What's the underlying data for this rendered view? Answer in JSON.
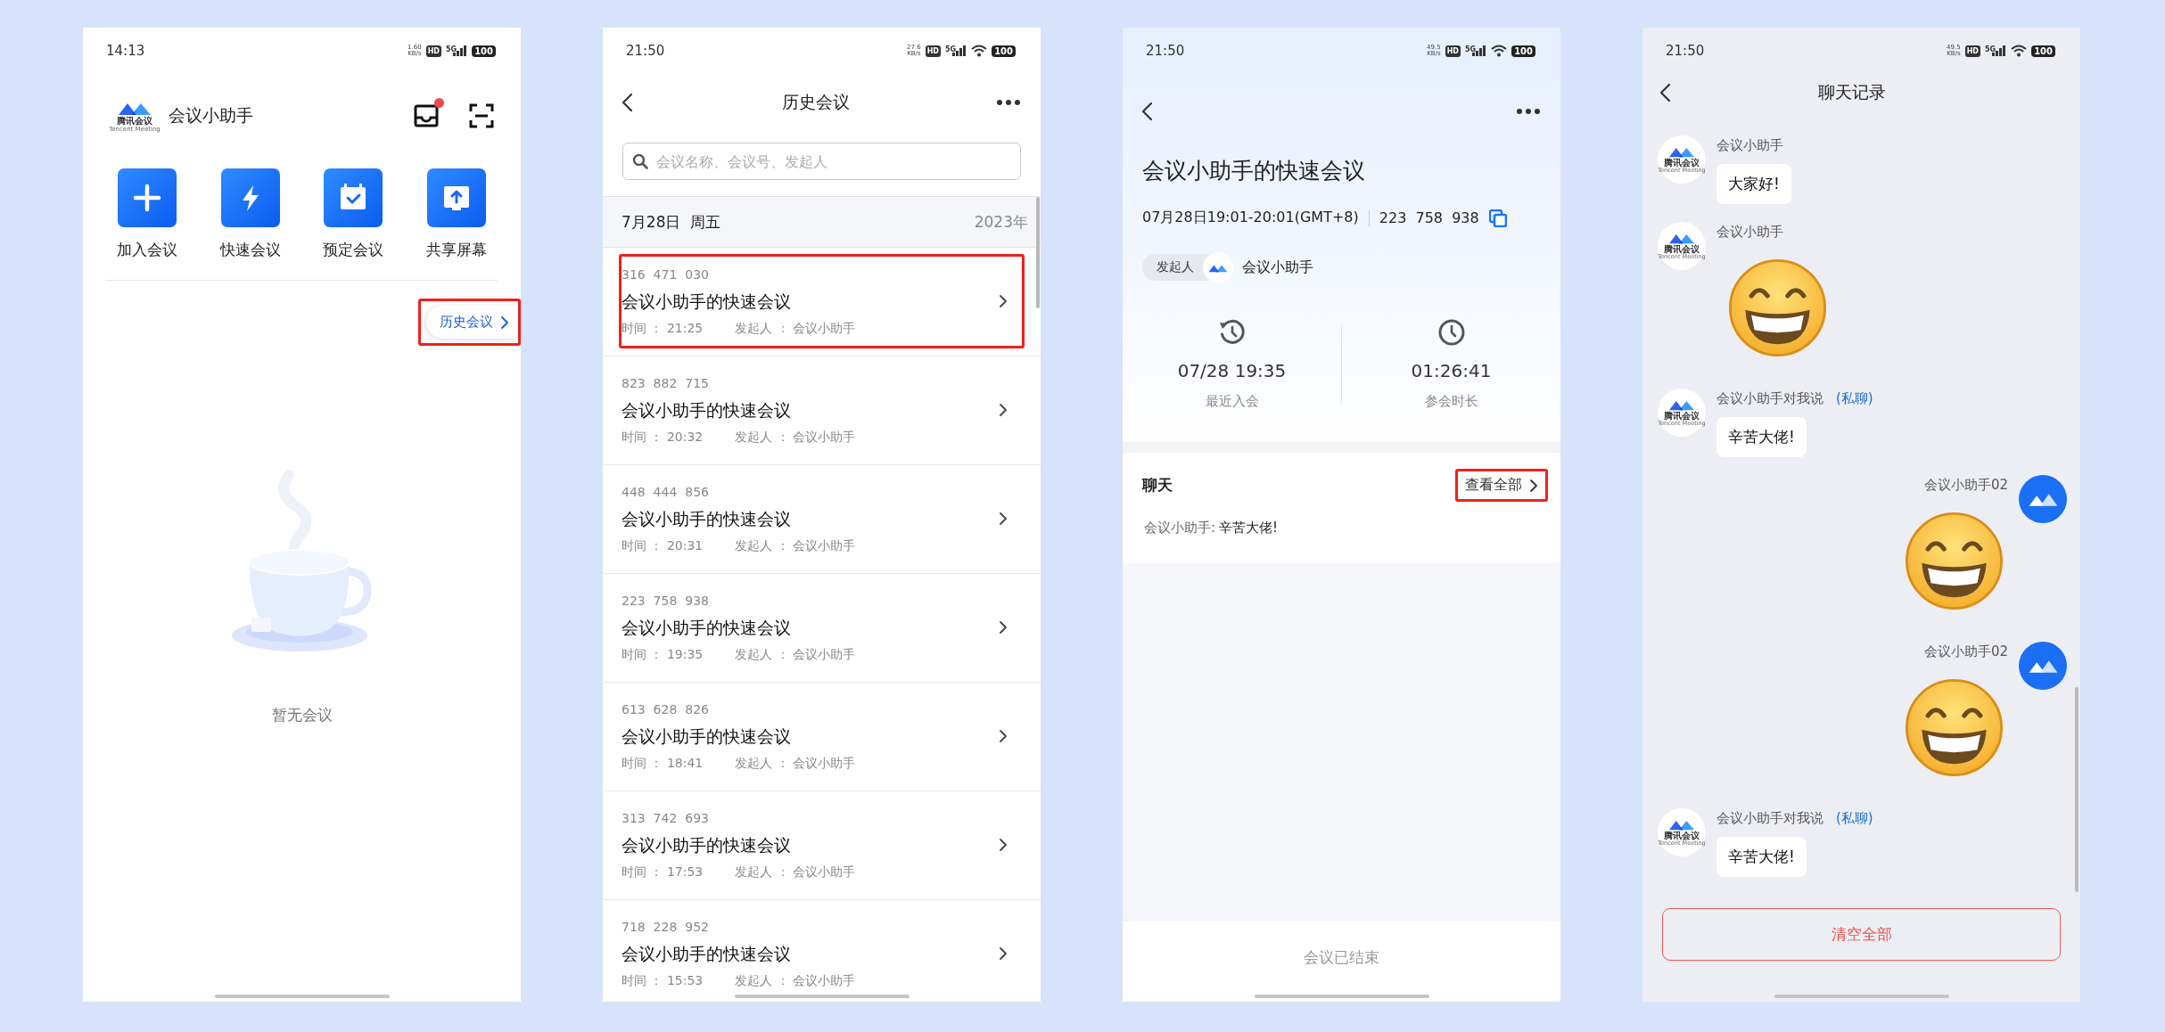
{
  "screens": [
    {
      "kind": "home",
      "status": {
        "time": "14:13",
        "speed": "1.60",
        "speed_unit": "KB/s",
        "hd": "HD",
        "network": "5G",
        "wifi": false,
        "battery": "100"
      },
      "logo": {
        "name": "腾讯会议",
        "sub": "Tencent Meeting"
      },
      "app_title": "会议小助手",
      "inbox_unread": true,
      "actions": [
        {
          "label": "加入会议",
          "kind": "plus"
        },
        {
          "label": "快速会议",
          "kind": "bolt"
        },
        {
          "label": "预定会议",
          "kind": "calendar"
        },
        {
          "label": "共享屏幕",
          "kind": "share"
        }
      ],
      "history_button": {
        "label": "历史会议",
        "highlighted": true
      },
      "empty_text": "暂无会议"
    },
    {
      "kind": "history",
      "status": {
        "time": "21:50",
        "speed": "27.6",
        "speed_unit": "KB/s",
        "hd": "HD",
        "network": "5G",
        "wifi": true,
        "battery": "100"
      },
      "title": "历史会议",
      "search": {
        "placeholder": "会议名称、会议号、发起人"
      },
      "date_header": {
        "date": "7月28日  周五",
        "year": "2023年"
      },
      "meetings": [
        {
          "number": "316  471  030",
          "title": "会议小助手的快速会议",
          "time": "时间 ： 21:25",
          "host": "发起人 ： 会议小助手",
          "highlighted": true
        },
        {
          "number": "823  882  715",
          "title": "会议小助手的快速会议",
          "time": "时间 ： 20:32",
          "host": "发起人 ： 会议小助手",
          "highlighted": false
        },
        {
          "number": "448  444  856",
          "title": "会议小助手的快速会议",
          "time": "时间 ： 20:31",
          "host": "发起人 ： 会议小助手",
          "highlighted": false
        },
        {
          "number": "223  758  938",
          "title": "会议小助手的快速会议",
          "time": "时间 ： 19:35",
          "host": "发起人 ： 会议小助手",
          "highlighted": false
        },
        {
          "number": "613  628  826",
          "title": "会议小助手的快速会议",
          "time": "时间 ： 18:41",
          "host": "发起人 ： 会议小助手",
          "highlighted": false
        },
        {
          "number": "313  742  693",
          "title": "会议小助手的快速会议",
          "time": "时间 ： 17:53",
          "host": "发起人 ： 会议小助手",
          "highlighted": false
        },
        {
          "number": "718  228  952",
          "title": "会议小助手的快速会议",
          "time": "时间 ： 15:53",
          "host": "发起人 ： 会议小助手",
          "highlighted": false
        }
      ]
    },
    {
      "kind": "detail",
      "status": {
        "time": "21:50",
        "speed": "49.5",
        "speed_unit": "KB/s",
        "hd": "HD",
        "network": "5G",
        "wifi": true,
        "battery": "100"
      },
      "title": "会议小助手的快速会议",
      "time_range": "07月28日19:01-20:01(GMT+8)",
      "number": "223  758  938",
      "host_tag": "发起人",
      "host_name": "会议小助手",
      "stats": [
        {
          "kind": "history",
          "value": "07/28 19:35",
          "label": "最近入会"
        },
        {
          "kind": "clock",
          "value": "01:26:41",
          "label": "参会时长"
        }
      ],
      "chat": {
        "title": "聊天",
        "view_all": {
          "label": "查看全部",
          "highlighted": true
        },
        "preview_sender": "会议小助手:",
        "preview_text": "辛苦大佬!"
      },
      "footer": "会议已结束"
    },
    {
      "kind": "chat",
      "status": {
        "time": "21:50",
        "speed": "49.5",
        "speed_unit": "KB/s",
        "hd": "HD",
        "network": "5G",
        "wifi": true,
        "battery": "100"
      },
      "title": "聊天记录",
      "messages": [
        {
          "outgoing": false,
          "avatar": {
            "kind": "logo",
            "name": "腾讯会议",
            "sub": "Tencent Meeting"
          },
          "sender": "会议小助手",
          "kind": "text",
          "text": "大家好!"
        },
        {
          "outgoing": false,
          "avatar": {
            "kind": "logo",
            "name": "腾讯会议",
            "sub": "Tencent Meeting"
          },
          "sender": "会议小助手",
          "kind": "emoji"
        },
        {
          "outgoing": false,
          "avatar": {
            "kind": "logo",
            "name": "腾讯会议",
            "sub": "Tencent Meeting"
          },
          "sender": "会议小助手对我说",
          "private_tag": "(私聊)",
          "kind": "text",
          "text": "辛苦大佬!"
        },
        {
          "outgoing": true,
          "avatar": {
            "kind": "blue"
          },
          "sender": "会议小助手02",
          "kind": "emoji"
        },
        {
          "outgoing": true,
          "avatar": {
            "kind": "blue"
          },
          "sender": "会议小助手02",
          "kind": "emoji"
        },
        {
          "outgoing": false,
          "avatar": {
            "kind": "logo",
            "name": "腾讯会议",
            "sub": "Tencent Meeting"
          },
          "sender": "会议小助手对我说",
          "private_tag": "(私聊)",
          "kind": "text",
          "text": "辛苦大佬!"
        }
      ],
      "clear_button": "清空全部"
    }
  ]
}
